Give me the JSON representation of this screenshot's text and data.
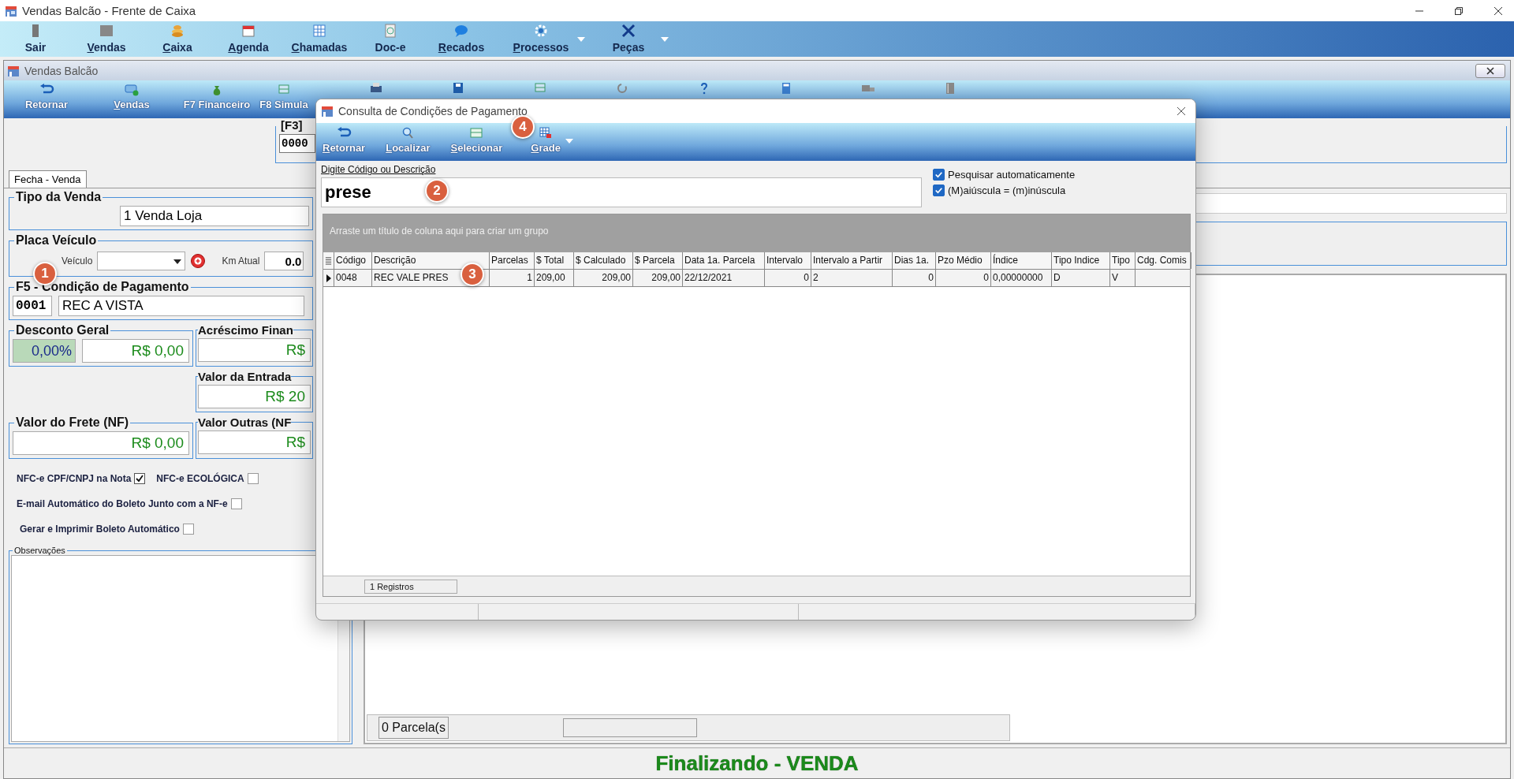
{
  "window": {
    "title": "Vendas Balcão - Frente de Caixa"
  },
  "main_toolbar": [
    {
      "label": "Sair",
      "kind": "door",
      "menu": false,
      "mnemonic": false
    },
    {
      "label": "Vendas",
      "kind": "box",
      "menu": false,
      "mnemonic": true
    },
    {
      "label": "Caixa",
      "kind": "coins",
      "menu": false,
      "mnemonic": true
    },
    {
      "label": "Agenda",
      "kind": "calendar",
      "menu": false,
      "mnemonic": true
    },
    {
      "label": "Chamadas",
      "kind": "grid",
      "menu": false,
      "mnemonic": true
    },
    {
      "label": "Doc-e",
      "kind": "document",
      "menu": false,
      "mnemonic": false
    },
    {
      "label": "Recados",
      "kind": "chat",
      "menu": false,
      "mnemonic": true
    },
    {
      "label": "Processos",
      "kind": "gear",
      "menu": true,
      "mnemonic": true
    },
    {
      "label": "Peças",
      "kind": "tools",
      "menu": true,
      "mnemonic": false
    }
  ],
  "inner_window": {
    "title": "Vendas Balcão"
  },
  "inner_toolbar": [
    {
      "label": "Retornar",
      "kind": "back",
      "mnemonic": false
    },
    {
      "label": "Vendas",
      "kind": "cards",
      "mnemonic": true
    },
    {
      "label": "F7 Financeiro",
      "kind": "moneybag",
      "mnemonic": false
    },
    {
      "label": "F8 Simula",
      "kind": "grid",
      "mnemonic": false
    },
    {
      "kind": "printer"
    },
    {
      "kind": "disk"
    },
    {
      "kind": "grid"
    },
    {
      "kind": "refresh"
    },
    {
      "kind": "help"
    },
    {
      "kind": "calculator"
    },
    {
      "kind": "truck"
    },
    {
      "kind": "book"
    }
  ],
  "header": {
    "label": "[F3]",
    "value": "0000"
  },
  "tabs": [
    {
      "label": "Fecha - Venda",
      "selected": true
    }
  ],
  "sale": {
    "tipo_venda": {
      "label": "Tipo da Venda",
      "value": "1 Venda Loja"
    },
    "placa": {
      "label": "Placa Veículo",
      "field_label": "Veículo",
      "km_label": "Km Atual",
      "km_value": "0.0"
    },
    "condicao": {
      "label": "F5 - Condição de Pagamento",
      "code": "0001",
      "name": "REC A VISTA"
    },
    "desconto": {
      "label": "Desconto Geral",
      "percent": "0,00%",
      "value": "R$ 0,00"
    },
    "acrescimo": {
      "label": "Acréscimo Finan",
      "value": "R$"
    },
    "entrada": {
      "label": "Valor da Entrada",
      "value": "R$ 20"
    },
    "frete": {
      "label": "Valor do Frete (NF)",
      "value": "R$ 0,00"
    },
    "outras": {
      "label": "Valor Outras (NF",
      "value": "R$"
    },
    "options": [
      [
        {
          "label": "NFC-e CPF/CNPJ na Nota",
          "checked": true
        },
        {
          "label": "NFC-e ECOLÓGICA",
          "checked": false
        }
      ],
      [
        {
          "label": "E-mail Automático do Boleto Junto com a NF-e",
          "checked": false
        }
      ],
      [
        {
          "label": "Gerar e Imprimir Boleto Automático",
          "checked": false
        }
      ]
    ],
    "observacoes": {
      "label": "Observações"
    }
  },
  "parcelas": {
    "count": "0 Parcela(s"
  },
  "status": "Finalizando - VENDA",
  "dialog": {
    "title": "Consulta de Condições de Pagamento",
    "toolbar": [
      {
        "label": "Retornar",
        "kind": "back",
        "menu": false
      },
      {
        "label": "Localizar",
        "kind": "search",
        "menu": false
      },
      {
        "label": "Selecionar",
        "kind": "select",
        "menu": false
      },
      {
        "label": "Grade",
        "kind": "grid",
        "menu": true
      }
    ],
    "search": {
      "label": "Digite Código ou Descrição",
      "value": "prese"
    },
    "options": [
      {
        "label": "Pesquisar automaticamente",
        "checked": true
      },
      {
        "label": "(M)aiúscula = (m)inúscula",
        "checked": true
      }
    ],
    "group_hint": "Arraste um título de coluna aqui para criar um grupo",
    "table": {
      "columns": [
        "Código",
        "Descrição",
        "Parcelas",
        "$ Total",
        "$ Calculado",
        "$ Parcela",
        "Data 1a. Parcela",
        "Intervalo",
        "Intervalo a Partir",
        "Dias 1a.",
        "Pzo Médio",
        "Índice",
        "Tipo Indice",
        "Tipo",
        "Cdg. Comis"
      ],
      "rows": [
        {
          "selected": true,
          "cells": [
            "0048",
            "REC VALE PRES",
            "1",
            "209,00",
            "209,00",
            "209,00",
            "22/12/2021",
            "0",
            "2",
            "0",
            "0",
            "0,00000000",
            "D",
            "V"
          ]
        }
      ]
    },
    "footer": "1 Registros"
  },
  "callouts": [
    "1",
    "2",
    "3",
    "4"
  ]
}
